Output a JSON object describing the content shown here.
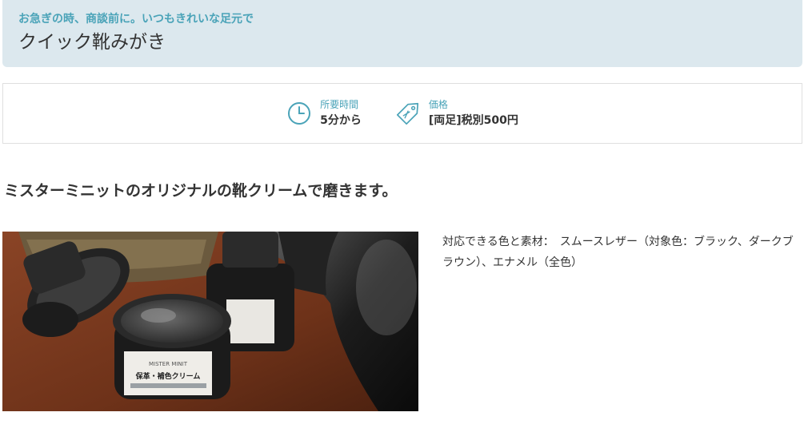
{
  "hero": {
    "subtitle": "お急ぎの時、商談前に。いつもきれいな足元で",
    "title": "クイック靴みがき"
  },
  "info": {
    "items": [
      {
        "icon": "clock-icon",
        "label": "所要時間",
        "value": "5分から"
      },
      {
        "icon": "price-tag-icon",
        "label": "価格",
        "value": "[両足]税別500円"
      }
    ]
  },
  "lead": "ミスターミニットのオリジナルの靴クリームで磨きます。",
  "photo": {
    "jar_brand": "MISTER MINIT",
    "jar_label": "保革・補色クリーム"
  },
  "description": "対応できる色と素材：　スムースレザー（対象色：ブラック、ダークブラウン）、エナメル（全色）",
  "colors": {
    "accent": "#4aa3b8",
    "hero_bg": "#dce8ee",
    "text": "#333333"
  }
}
